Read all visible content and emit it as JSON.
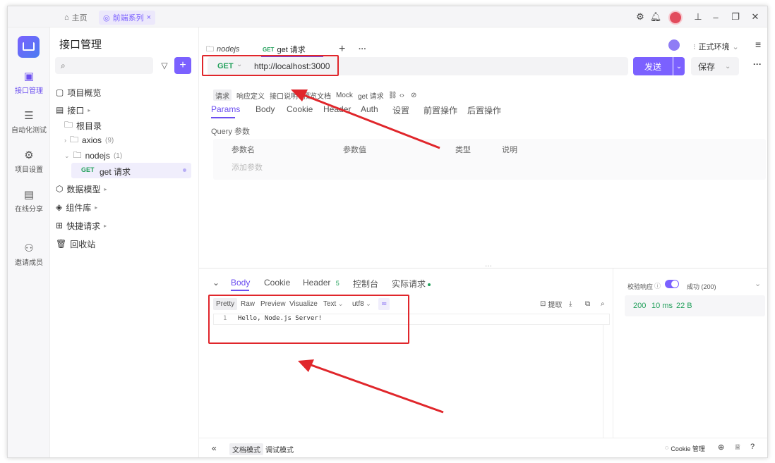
{
  "titlebar": {
    "home_label": "主页",
    "project_tab_label": "前端系列"
  },
  "nav": [
    {
      "label": "接口管理"
    },
    {
      "label": "自动化测试"
    },
    {
      "label": "项目设置"
    },
    {
      "label": "在线分享"
    },
    {
      "label": "邀请成员"
    }
  ],
  "sidebar": {
    "title": "接口管理",
    "items": {
      "overview": "项目概览",
      "api": "接口",
      "root": "根目录",
      "axios": "axios",
      "axios_count": "(9)",
      "nodejs": "nodejs",
      "nodejs_count": "(1)",
      "get_method": "GET",
      "get_name": "get 请求",
      "models": "数据模型",
      "components": "组件库",
      "quick": "快捷请求",
      "trash": "回收站"
    }
  },
  "tabs": {
    "tab1": "nodejs",
    "tab2_method": "GET",
    "tab2": "get 请求",
    "add": "+",
    "more": "···"
  },
  "env": {
    "label": "正式环境"
  },
  "request": {
    "method": "GET",
    "url": "http://localhost:3000",
    "send": "发送",
    "save": "保存",
    "more": "···"
  },
  "subtabs": [
    "请求",
    "响应定义",
    "接口说明",
    "预览文档",
    "Mock",
    "get 请求"
  ],
  "params_tabs": [
    "Params",
    "Body",
    "Cookie",
    "Header",
    "Auth",
    "设置",
    "前置操作",
    "后置操作"
  ],
  "query": {
    "title": "Query 参数",
    "col_name": "参数名",
    "col_value": "参数值",
    "col_type": "类型",
    "col_desc": "说明",
    "add": "添加参数"
  },
  "response": {
    "tabs": {
      "body": "Body",
      "cookie": "Cookie",
      "header": "Header",
      "header_count": "5",
      "console": "控制台",
      "actual": "实际请求"
    },
    "formats": [
      "Pretty",
      "Raw",
      "Preview",
      "Visualize",
      "Text",
      "utf8"
    ],
    "extract": "提取",
    "line_no": "1",
    "content": "Hello, Node.js Server!",
    "validate": "校验响应",
    "status": "成功 (200)",
    "code": "200",
    "time": "10 ms",
    "size": "22 B"
  },
  "bottom": {
    "doc_mode": "文档模式",
    "debug_mode": "调试模式",
    "cookie_mgmt": "Cookie 管理"
  },
  "colors": {
    "accent": "#6b4ef0",
    "get": "#22a05b",
    "annotation": "#e0262b"
  }
}
